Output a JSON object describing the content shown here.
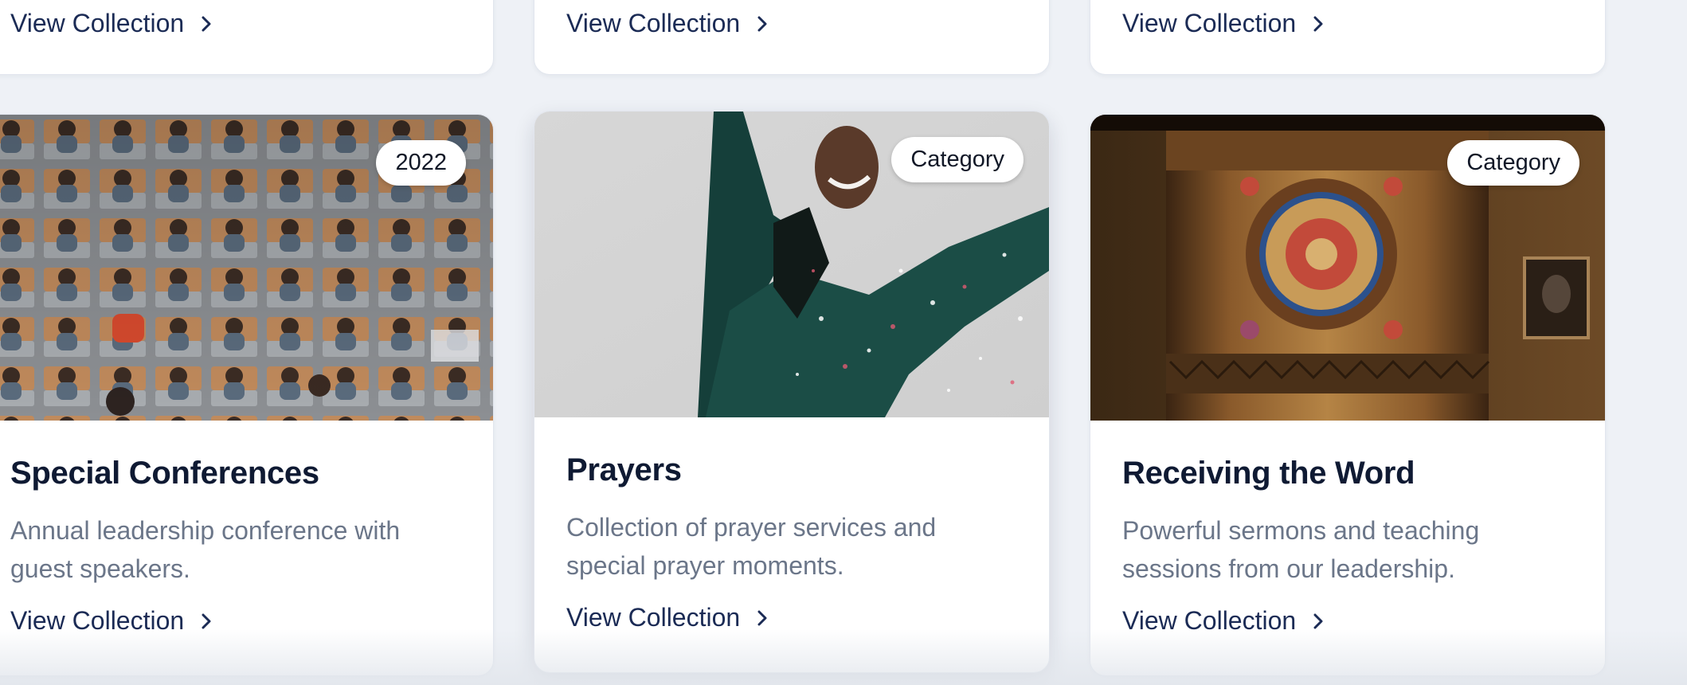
{
  "top_cards": [
    {
      "link_label": "View Collection"
    },
    {
      "link_label": "View Collection"
    },
    {
      "link_label": "View Collection"
    }
  ],
  "cards": [
    {
      "badge": "2022",
      "title": "Special Conferences",
      "description": "Annual leadership conference with guest speakers.",
      "link_label": "View Collection",
      "image": "conference-audience-photo"
    },
    {
      "badge": "Category",
      "title": "Prayers",
      "description": "Collection of prayer services and special prayer moments.",
      "link_label": "View Collection",
      "image": "celebrating-woman-confetti-photo"
    },
    {
      "badge": "Category",
      "title": "Receiving the Word",
      "description": "Powerful sermons and teaching sessions from our leadership.",
      "link_label": "View Collection",
      "image": "ornate-wooden-pulpit-photo"
    }
  ],
  "icons": {
    "link_arrow": "chevron-right-icon"
  },
  "colors": {
    "page_bg": "#eef1f6",
    "card_bg": "#ffffff",
    "link": "#1b2b55",
    "title": "#0f1a33",
    "description": "#6b7689"
  }
}
